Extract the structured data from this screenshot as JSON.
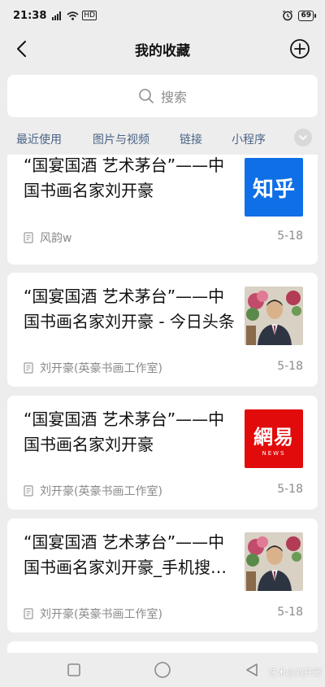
{
  "status_bar": {
    "time": "21:38",
    "signal": "4G",
    "hd": "HD",
    "battery": "69"
  },
  "nav": {
    "title": "我的收藏",
    "back_icon": "chevron-left-icon",
    "add_icon": "plus-circle-icon"
  },
  "search": {
    "placeholder": "搜索",
    "icon": "search-icon"
  },
  "tabs": [
    {
      "label": "最近使用"
    },
    {
      "label": "图片与视频"
    },
    {
      "label": "链接"
    },
    {
      "label": "小程序"
    }
  ],
  "items": [
    {
      "title": "“国宴国酒 艺术茅台”——中国书画名家刘开豪",
      "source": "风韵w",
      "date": "5-18",
      "thumb_type": "zhihu",
      "thumb_text": "知乎"
    },
    {
      "title": "“国宴国酒 艺术茅台”——中国书画名家刘开豪 - 今日头条",
      "source": "刘开豪(英豪书画工作室)",
      "date": "5-18",
      "thumb_type": "photo"
    },
    {
      "title": "“国宴国酒 艺术茅台”——中国书画名家刘开豪",
      "source": "刘开豪(英豪书画工作室)",
      "date": "5-18",
      "thumb_type": "netease",
      "thumb_text": "網易",
      "thumb_sub": "NEWS"
    },
    {
      "title": "“国宴国酒 艺术茅台”——中国书画名家刘开豪_手机搜狐网",
      "source": "刘开豪(英豪书画工作室)",
      "date": "5-18",
      "thumb_type": "photo"
    }
  ],
  "watermark": "艺术@刘开豪",
  "colors": {
    "background": "#ededed",
    "card": "#ffffff",
    "tab_text": "#4a6486",
    "zhihu_blue": "#0f6fe6",
    "netease_red": "#e20b0b"
  }
}
